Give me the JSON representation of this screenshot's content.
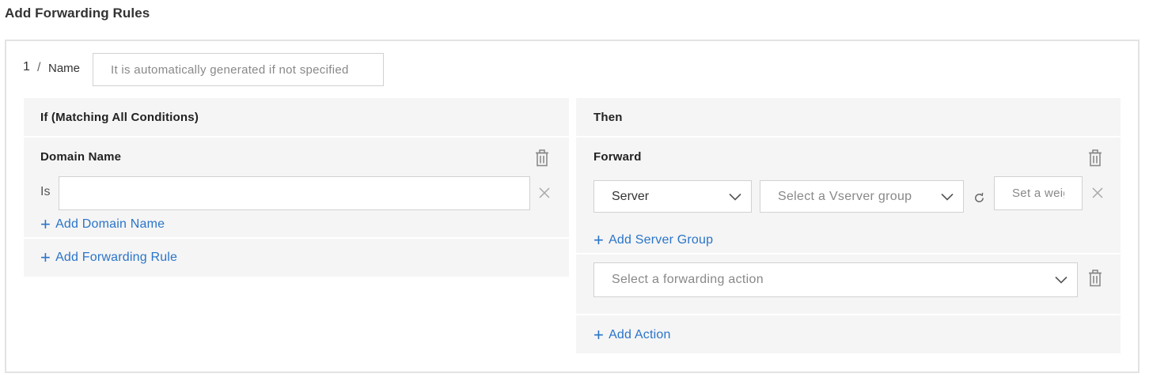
{
  "page": {
    "title": "Add Forwarding Rules"
  },
  "rule": {
    "index": "1",
    "separator": "/",
    "name_label": "Name",
    "name_placeholder": "It is automatically generated if not specified"
  },
  "if_panel": {
    "heading": "If (Matching All Conditions)",
    "condition": {
      "title": "Domain Name",
      "operator": "Is",
      "value": ""
    },
    "add_domain_label": "Add Domain Name",
    "add_rule_label": "Add Forwarding Rule"
  },
  "then_panel": {
    "heading": "Then",
    "forward": {
      "title": "Forward",
      "target_type": "Server",
      "vserver_group_placeholder": "Select a Vserver group",
      "weight_placeholder": "Set a weight"
    },
    "add_server_group_label": "Add Server Group",
    "action_placeholder": "Select a forwarding action",
    "add_action_label": "Add Action"
  },
  "icons": {
    "delete": "trash-icon",
    "remove": "close-icon",
    "dropdown": "chevron-down-icon",
    "refresh": "refresh-icon",
    "add": "plus-icon"
  },
  "colors": {
    "link": "#2a74c9",
    "panel_bg": "#f5f5f5",
    "border": "#d1d1d1"
  }
}
